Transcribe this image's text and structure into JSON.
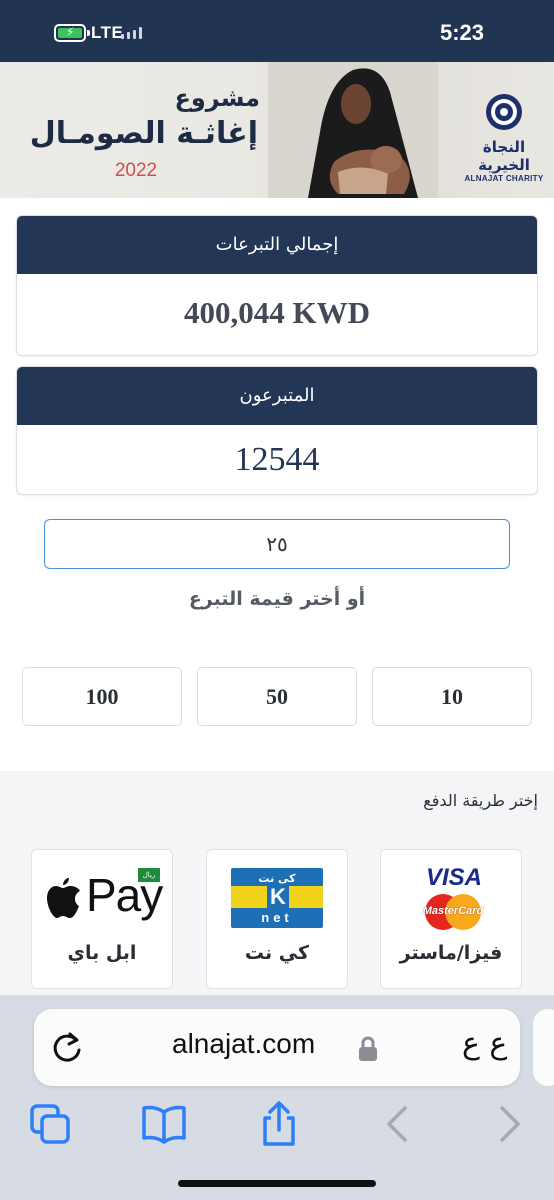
{
  "status_bar": {
    "network": "LTE",
    "time": "5:23"
  },
  "banner": {
    "title_line1": "مشروع",
    "title_line2": "إغاثـة الصومـال",
    "year": "2022",
    "logo_ar": "النجاة الخيرية",
    "logo_en": "ALNAJAT CHARITY"
  },
  "total_card": {
    "label": "إجمالي التبرعات",
    "value": "400,044 KWD"
  },
  "donors_card": {
    "label": "المتبرعون",
    "value": "12544"
  },
  "amount_input": {
    "value": "٢٥"
  },
  "choose_amount_label": "أو أختر قيمة التبرع",
  "amount_options": [
    "10",
    "50",
    "100"
  ],
  "payment": {
    "label": "إختر طريقة الدفع",
    "methods": [
      {
        "name": "فيزا/ماستر",
        "visa_text": "VISA",
        "mc_text": "MasterCard"
      },
      {
        "name": "كي نت",
        "knet_top": "كي نت",
        "knet_letter": "K",
        "knet_bottom": "net"
      },
      {
        "name": "ابل باي",
        "pay_text": "Pay",
        "badge_text": "ريال"
      }
    ]
  },
  "browser": {
    "url": "alnajat.com",
    "text_size_label": "ع ع"
  },
  "colors": {
    "header_navy": "#233656",
    "status_bar": "#213553",
    "accent_blue": "#2d7ff9",
    "year_red": "#d04e53"
  }
}
